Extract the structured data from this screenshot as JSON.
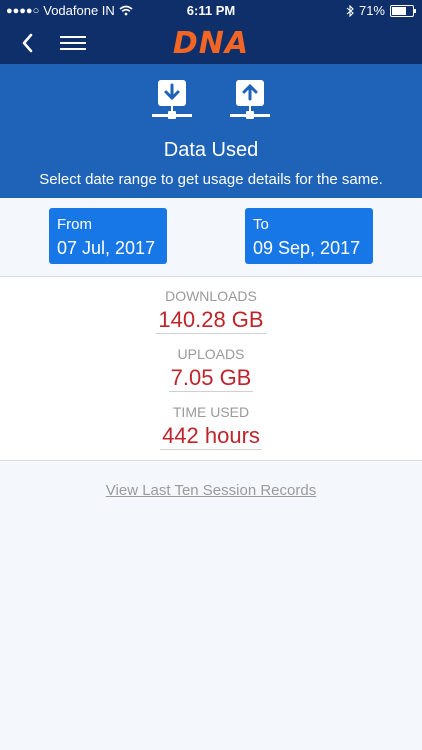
{
  "status_bar": {
    "carrier": "Vodafone IN",
    "time": "6:11 PM",
    "battery": "71%",
    "battery_level": 0.71
  },
  "nav": {
    "logo": "DNA"
  },
  "header": {
    "title": "Data Used",
    "subtitle": "Select date range to get usage details for the same."
  },
  "date_range": {
    "from_label": "From",
    "from_value": "07 Jul, 2017",
    "to_label": "To",
    "to_value": "09 Sep, 2017"
  },
  "stats": {
    "downloads_label": "DOWNLOADS",
    "downloads_value": "140.28 GB",
    "uploads_label": "UPLOADS",
    "uploads_value": "7.05 GB",
    "time_label": "TIME USED",
    "time_value": "442 hours"
  },
  "link": "View Last Ten Session Records",
  "colors": {
    "navbar": "#0f2f6b",
    "header": "#1e63b8",
    "date_button": "#1877e6",
    "value_red": "#c0242b",
    "logo_orange": "#f26522"
  }
}
